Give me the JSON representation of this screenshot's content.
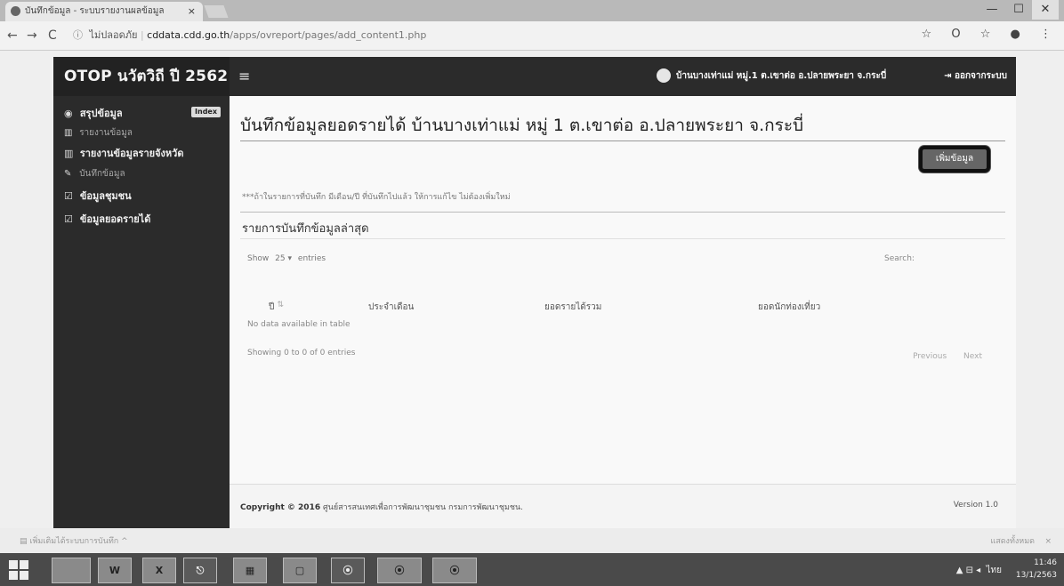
{
  "browser": {
    "tab_title": "บันทึกข้อมูล - ระบบรายงานผลข้อมูล",
    "tab_close": "×",
    "window_controls": [
      "—",
      "☐",
      "✕"
    ],
    "nav": {
      "back": "←",
      "forward": "→",
      "reload": "C"
    },
    "security_label": "ไม่ปลอดภัย",
    "url_host": "cddata.cdd.go.th",
    "url_path": "/apps/ovreport/pages/add_content1.php",
    "toolbar_icons": [
      "star-icon",
      "opera-icon",
      "extension-icon",
      "profile-icon"
    ]
  },
  "app": {
    "brand": "OTOP นวัตวิถี ปี 2562",
    "sidebar": {
      "items": [
        {
          "label": "สรุปข้อมูล",
          "type": "head",
          "icon": "dashboard-icon",
          "badge": "Index"
        },
        {
          "label": "รายงานข้อมูล",
          "type": "sub",
          "icon": "chart-icon"
        },
        {
          "label": "รายงานข้อมูลรายจังหวัด",
          "type": "head",
          "icon": "chart-icon"
        },
        {
          "label": "บันทึกข้อมูล",
          "type": "sub",
          "icon": "pencil-icon"
        },
        {
          "label": "ข้อมูลชุมชน",
          "type": "head",
          "icon": "edit-icon"
        },
        {
          "label": "ข้อมูลยอดรายได้",
          "type": "head",
          "icon": "edit-icon"
        }
      ]
    },
    "topbar": {
      "menu_icon": "≡",
      "user": "บ้านบางเท่าแม่ หมู่.1 ต.เขาต่อ อ.ปลายพระยา จ.กระบี่",
      "logout": "ออกจากระบบ"
    },
    "page_title": "บันทึกข้อมูลยอดรายได้ บ้านบางเท่าแม่ หมู่ 1 ต.เขาต่อ อ.ปลายพระยา จ.กระบี่",
    "add_button": "เพิ่มข้อมูล",
    "note": "***ถ้าในรายการที่บันทึก มีเดือน/ปี ที่บันทึกไปแล้ว ให้การแก้ไข ไม่ต้องเพิ่มใหม่",
    "section_title": "รายการบันทึกข้อมูลล่าสุด",
    "table": {
      "show_label": "Show",
      "page_size": "25",
      "entries_label": "entries",
      "search_label": "Search:",
      "columns": [
        "ปี",
        "ประจำเดือน",
        "ยอดรายได้รวม",
        "ยอดนักท่องเที่ยว"
      ],
      "empty_message": "No data available in table",
      "info": "Showing 0 to 0 of 0 entries",
      "pager": {
        "previous": "Previous",
        "next": "Next"
      }
    },
    "footer": {
      "copyright_prefix": "Copyright © 2016",
      "copyright_org": "ศูนย์สารสนเทศเพื่อการพัฒนาชุมชน กรมการพัฒนาชุมชน.",
      "version": "Version 1.0"
    }
  },
  "downloads": {
    "item": "เพิ่มเติมได้ระบบการบันทึก",
    "show_all": "แสดงทั้งหมด"
  },
  "taskbar": {
    "apps": [
      "W",
      "X",
      "⎋",
      "▦",
      "▢",
      "⦿",
      "⦿",
      "⦿"
    ],
    "tray_icons": "▲ ⊟ ◂",
    "language": "ไทย",
    "time": "11:46",
    "date": "13/1/2563"
  }
}
